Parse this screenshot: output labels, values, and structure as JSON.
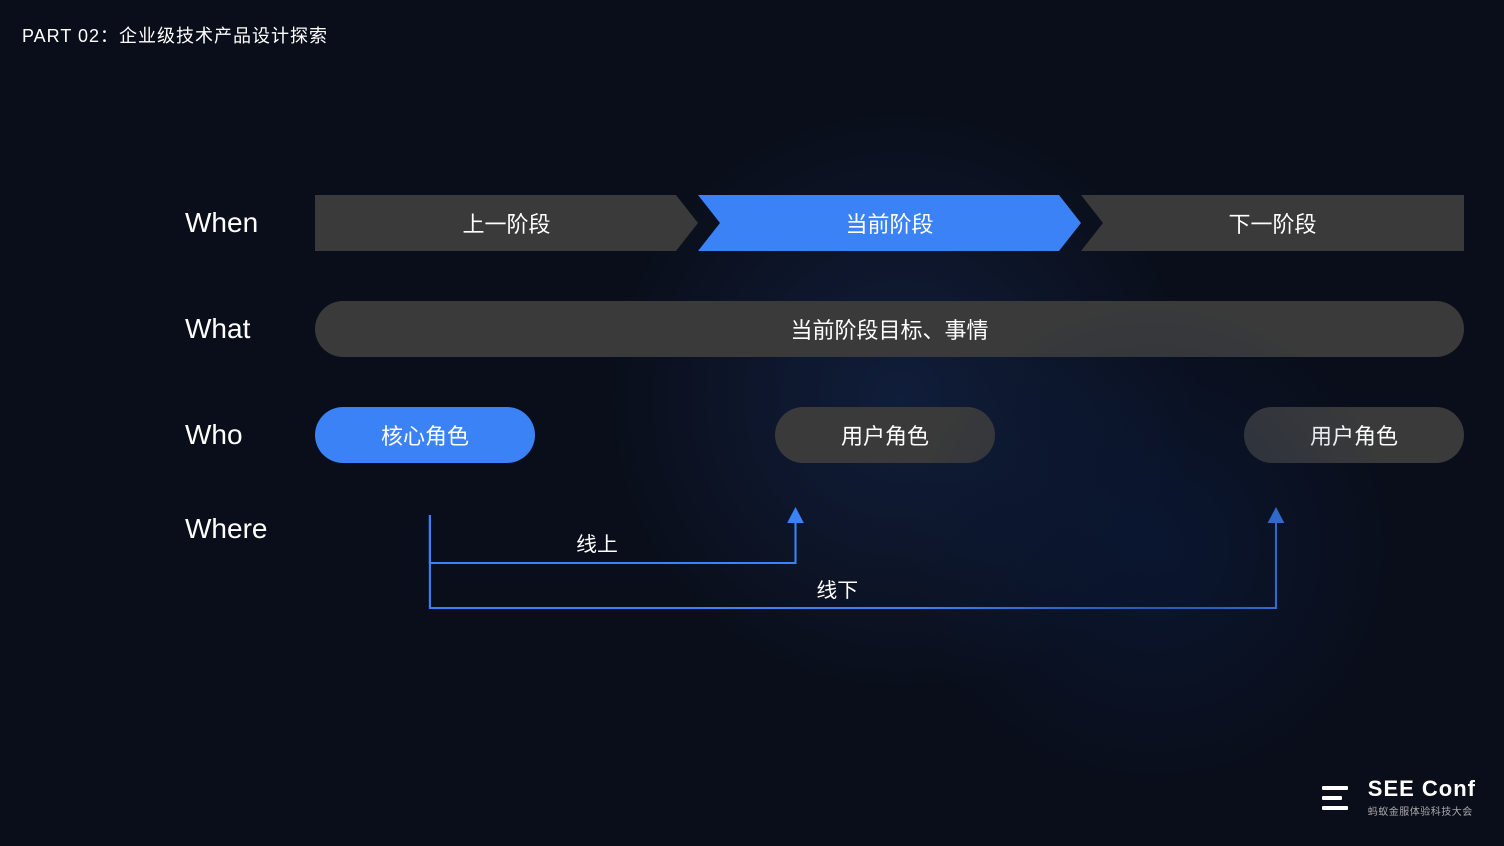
{
  "part_label": "PART 02：企业级技术产品设计探索",
  "rows": {
    "when": {
      "label": "When",
      "items": [
        {
          "text": "上一阶段",
          "active": false
        },
        {
          "text": "当前阶段",
          "active": true
        },
        {
          "text": "下一阶段",
          "active": false
        }
      ]
    },
    "what": {
      "label": "What",
      "text": "当前阶段目标、事情"
    },
    "who": {
      "label": "Who",
      "items": [
        {
          "text": "核心角色",
          "type": "blue"
        },
        {
          "text": "用户角色",
          "type": "dark"
        },
        {
          "text": "用户角色",
          "type": "dark"
        }
      ]
    },
    "where": {
      "label": "Where",
      "connections": [
        {
          "label": "线上",
          "type": "online"
        },
        {
          "label": "线下",
          "type": "offline"
        }
      ]
    }
  },
  "logo": {
    "title": "SEE Conf",
    "subtitle": "蚂蚁金服体验科技大会"
  },
  "colors": {
    "accent_blue": "#3b82f6",
    "dark_pill": "#3a3a3a",
    "bg": "#0a0e1a"
  }
}
